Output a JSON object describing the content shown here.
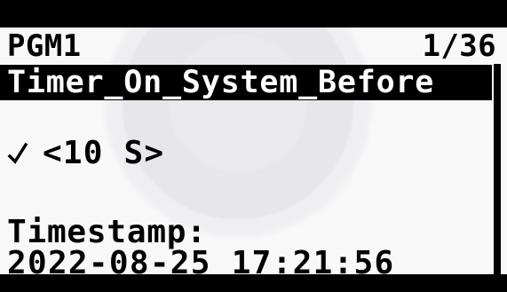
{
  "header": {
    "program_label": "PGM1",
    "page_indicator": "1/36"
  },
  "selected_item": {
    "label": "Timer_On_System_Before"
  },
  "setting": {
    "value_label": "<10 S>"
  },
  "timestamp": {
    "label": "Timestamp:",
    "value": "2022-08-25 17:21:56"
  },
  "icons": {
    "check": "check-icon",
    "scrollbar": "scrollbar"
  }
}
